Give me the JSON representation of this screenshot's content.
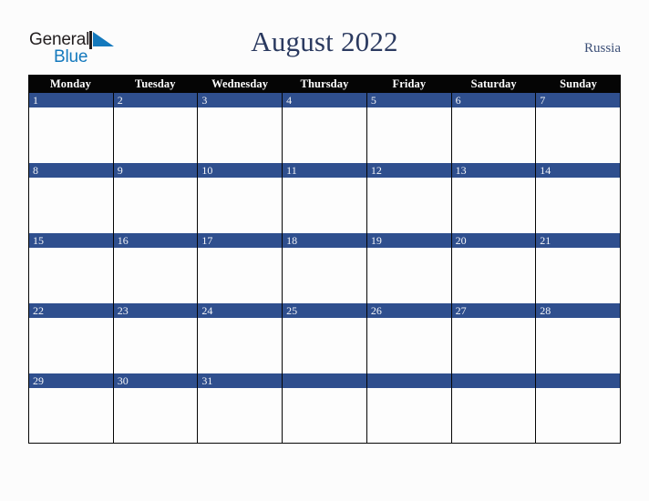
{
  "logo": {
    "word_one": "General",
    "word_two": "Blue",
    "mark_name": "blue-triangle-flag-mark",
    "color_dark": "#231f20",
    "color_blue": "#1479bd"
  },
  "header": {
    "title": "August 2022",
    "country": "Russia",
    "title_color": "#2b3a60",
    "country_color": "#3c4f77"
  },
  "calendar": {
    "weekdays": [
      "Monday",
      "Tuesday",
      "Wednesday",
      "Thursday",
      "Friday",
      "Saturday",
      "Sunday"
    ],
    "header_bg": "#050505",
    "header_text_color": "#ffffff",
    "date_bar_bg": "#2f4f8e",
    "date_text_color": "#f2f4f8",
    "cell_bg": "#fdfdfd",
    "border_color": "#050505",
    "weeks": [
      {
        "days": [
          {
            "num": "1"
          },
          {
            "num": "2"
          },
          {
            "num": "3"
          },
          {
            "num": "4"
          },
          {
            "num": "5"
          },
          {
            "num": "6"
          },
          {
            "num": "7"
          }
        ]
      },
      {
        "days": [
          {
            "num": "8"
          },
          {
            "num": "9"
          },
          {
            "num": "10"
          },
          {
            "num": "11"
          },
          {
            "num": "12"
          },
          {
            "num": "13"
          },
          {
            "num": "14"
          }
        ]
      },
      {
        "days": [
          {
            "num": "15"
          },
          {
            "num": "16"
          },
          {
            "num": "17"
          },
          {
            "num": "18"
          },
          {
            "num": "19"
          },
          {
            "num": "20"
          },
          {
            "num": "21"
          }
        ]
      },
      {
        "days": [
          {
            "num": "22"
          },
          {
            "num": "23"
          },
          {
            "num": "24"
          },
          {
            "num": "25"
          },
          {
            "num": "26"
          },
          {
            "num": "27"
          },
          {
            "num": "28"
          }
        ]
      },
      {
        "days": [
          {
            "num": "29"
          },
          {
            "num": "30"
          },
          {
            "num": "31"
          },
          {
            "num": ""
          },
          {
            "num": ""
          },
          {
            "num": ""
          },
          {
            "num": ""
          }
        ]
      }
    ]
  }
}
